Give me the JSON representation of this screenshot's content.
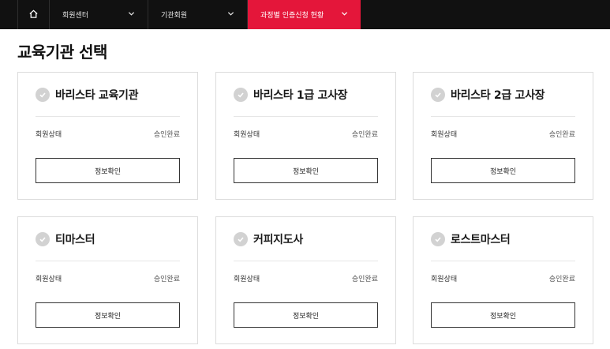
{
  "nav": {
    "home_icon": "home-icon",
    "items": [
      {
        "label": "회원센터",
        "icon": "chevron-down-icon"
      },
      {
        "label": "기관회원",
        "icon": "chevron-down-icon"
      },
      {
        "label": "과정별 인증신청 현황",
        "icon": "chevron-down-icon",
        "active": true,
        "color": "#e4163a"
      }
    ]
  },
  "page": {
    "title": "교육기관 선택"
  },
  "cards": [
    {
      "name": "바리스타 교육기관",
      "status_label": "회원상태",
      "status_value": "승인완료",
      "button": "정보확인"
    },
    {
      "name": "바리스타 1급 고사장",
      "status_label": "회원상태",
      "status_value": "승인완료",
      "button": "정보확인"
    },
    {
      "name": "바리스타 2급 고사장",
      "status_label": "회원상태",
      "status_value": "승인완료",
      "button": "정보확인"
    },
    {
      "name": "티마스터",
      "status_label": "회원상태",
      "status_value": "승인완료",
      "button": "정보확인"
    },
    {
      "name": "커피지도사",
      "status_label": "회원상태",
      "status_value": "승인완료",
      "button": "정보확인"
    },
    {
      "name": "로스트마스터",
      "status_label": "회원상태",
      "status_value": "승인완료",
      "button": "정보확인"
    }
  ]
}
